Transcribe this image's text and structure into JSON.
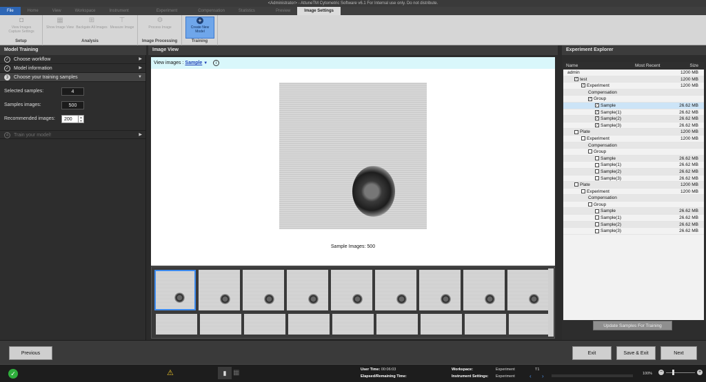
{
  "window": {
    "title": "<Administrator> - AttuneTM Cytometric Software v6.1 For Internal use only. Do not distribute."
  },
  "tabs": [
    "File",
    "Home",
    "View",
    "Workspace",
    "Instrument",
    "Experiment",
    "Compensation",
    "Statistics",
    "Preview",
    "Image Settings"
  ],
  "ribbon": {
    "groups": [
      {
        "label": "Setup",
        "buttons": [
          {
            "label": "View Images Capture Settings",
            "icon": "camera-icon"
          }
        ]
      },
      {
        "label": "Analysis",
        "buttons": [
          {
            "label": "Show Image View",
            "icon": "grid-icon"
          },
          {
            "label": "Backgate All Images",
            "icon": "backgate-icon"
          },
          {
            "label": "Measure Image",
            "icon": "ruler-icon"
          }
        ]
      },
      {
        "label": "Image Processing",
        "buttons": [
          {
            "label": "Process Image",
            "icon": "process-icon"
          }
        ]
      },
      {
        "label": "Training",
        "buttons": [
          {
            "label": "Create New Model",
            "icon": "plus-icon"
          }
        ]
      }
    ]
  },
  "model_training": {
    "header": "Model Training",
    "steps": [
      {
        "label": "Choose workflow",
        "marker": "✓"
      },
      {
        "label": "Model information",
        "marker": "✓"
      },
      {
        "label": "Choose your training samples",
        "marker": "3"
      }
    ],
    "fields": {
      "selected_label": "Selected samples:",
      "selected_value": "4",
      "images_label": "Samples images:",
      "images_value": "500",
      "recommended_label": "Recommended images:",
      "recommended_value": "200"
    },
    "step4": {
      "label": "Train your model!",
      "marker": "4"
    }
  },
  "image_view": {
    "header": "Image View",
    "view_label": "View images :",
    "view_selected": "Sample",
    "caption": "Sample Images: 500"
  },
  "explorer": {
    "header": "Experiment Explorer",
    "columns": {
      "name": "Name",
      "recent": "Most Recent",
      "size": "Size"
    },
    "rows": [
      {
        "name": "admin",
        "size": "1200 MB",
        "indent": 0
      },
      {
        "name": "test",
        "size": "1200 MB",
        "indent": 1,
        "chk": "✓"
      },
      {
        "name": "Experiment",
        "size": "1200 MB",
        "indent": 2,
        "chk": "✓"
      },
      {
        "name": "Compensation",
        "size": "",
        "indent": 3
      },
      {
        "name": "Group",
        "size": "",
        "indent": 3,
        "chk": "✓"
      },
      {
        "name": "Sample",
        "size": "26.62 MB",
        "indent": 4,
        "chk": "✓",
        "hl": true
      },
      {
        "name": "Sample(1)",
        "size": "26.62 MB",
        "indent": 4,
        "chk": "✓"
      },
      {
        "name": "Sample(2)",
        "size": "26.62 MB",
        "indent": 4,
        "chk": "✓"
      },
      {
        "name": "Sample(3)",
        "size": "26.62 MB",
        "indent": 4,
        "chk": "✓"
      },
      {
        "name": "Plate",
        "size": "1200 MB",
        "indent": 1,
        "chk": ""
      },
      {
        "name": "Experiment",
        "size": "1200 MB",
        "indent": 2,
        "chk": ""
      },
      {
        "name": "Compensation",
        "size": "",
        "indent": 3
      },
      {
        "name": "Group",
        "size": "",
        "indent": 3,
        "chk": ""
      },
      {
        "name": "Sample",
        "size": "26.62 MB",
        "indent": 4,
        "chk": ""
      },
      {
        "name": "Sample(1)",
        "size": "26.62 MB",
        "indent": 4,
        "chk": ""
      },
      {
        "name": "Sample(2)",
        "size": "26.62 MB",
        "indent": 4,
        "chk": ""
      },
      {
        "name": "Sample(3)",
        "size": "26.62 MB",
        "indent": 4,
        "chk": ""
      },
      {
        "name": "Plate",
        "size": "1200 MB",
        "indent": 1,
        "chk": ""
      },
      {
        "name": "Experiment",
        "size": "1200 MB",
        "indent": 2,
        "chk": ""
      },
      {
        "name": "Compensation",
        "size": "",
        "indent": 3
      },
      {
        "name": "Group",
        "size": "",
        "indent": 3,
        "chk": ""
      },
      {
        "name": "Sample",
        "size": "26.62 MB",
        "indent": 4,
        "chk": ""
      },
      {
        "name": "Sample(1)",
        "size": "26.62 MB",
        "indent": 4,
        "chk": ""
      },
      {
        "name": "Sample(2)",
        "size": "26.62 MB",
        "indent": 4,
        "chk": ""
      },
      {
        "name": "Sample(3)",
        "size": "26.62 MB",
        "indent": 4,
        "chk": ""
      }
    ],
    "update_button": "Update Samples For Training"
  },
  "footer": {
    "previous": "Previous",
    "exit": "Exit",
    "save_exit": "Save & Exit",
    "next": "Next"
  },
  "statusbar": {
    "user_time_label": "User Time:",
    "user_time": "00:06:03",
    "elapsed_label": "Elapsed/Remaining Time:",
    "workspace_label": "Workspace:",
    "workspace": "Experiment",
    "instr_label": "Instrument Settings:",
    "instr": "Experiment",
    "t_label": "T1",
    "zoom": "100%"
  }
}
